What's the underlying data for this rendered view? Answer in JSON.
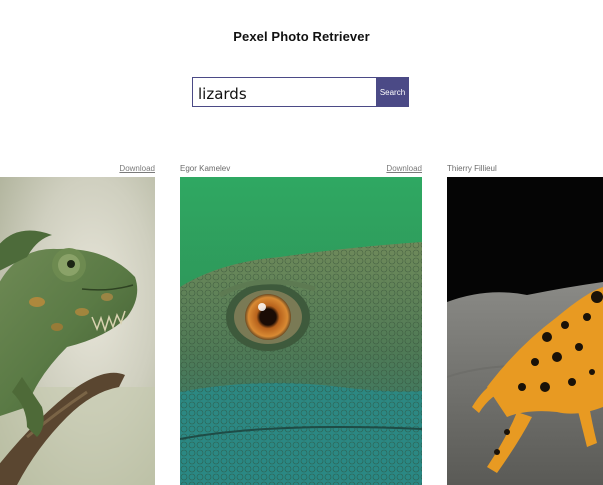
{
  "app": {
    "title": "Pexel Photo Retriever"
  },
  "search": {
    "value": "lizards",
    "button_label": "Search"
  },
  "results": [
    {
      "author": "",
      "download_label": "Download",
      "photo": "chameleon-photo"
    },
    {
      "author": "Egor Kamelev",
      "download_label": "Download",
      "photo": "lizard-eye-photo"
    },
    {
      "author": "Thierry Fillieul",
      "download_label": "",
      "photo": "orange-frog-photo"
    }
  ],
  "colors": {
    "accent": "#4b4a86",
    "muted_text": "#6b6b6b"
  }
}
